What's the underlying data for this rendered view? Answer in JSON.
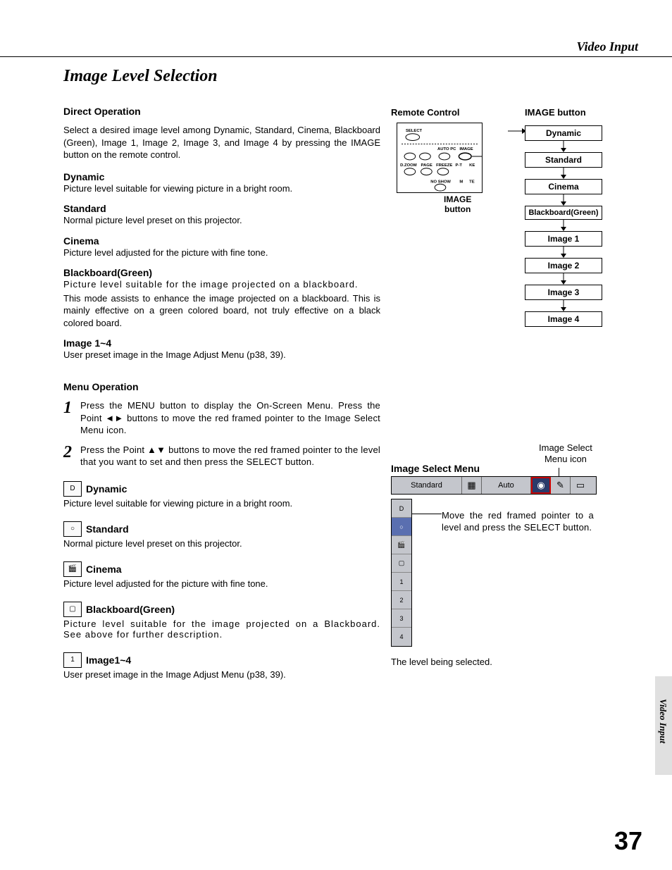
{
  "header": {
    "section": "Video Input"
  },
  "title": "Image Level Selection",
  "direct": {
    "heading": "Direct Operation",
    "intro": "Select a desired image level among Dynamic, Standard, Cinema, Blackboard (Green), Image 1, Image 2, Image 3, and Image 4 by pressing the IMAGE button on the remote control.",
    "defs": [
      {
        "t": "Dynamic",
        "b": "Picture level suitable for viewing picture in a bright room."
      },
      {
        "t": "Standard",
        "b": "Normal picture level preset on this projector."
      },
      {
        "t": "Cinema",
        "b": "Picture level adjusted for the picture with fine tone."
      },
      {
        "t": "Blackboard(Green)",
        "b": "Picture level suitable for the image projected on a blackboard.",
        "b2": "This mode assists to enhance the image projected on a blackboard.  This is mainly effective on a green colored board, not truly effective on a black colored board."
      },
      {
        "t": "Image 1~4",
        "b": "User preset image in the Image Adjust Menu (p38, 39)."
      }
    ]
  },
  "menu": {
    "heading": "Menu Operation",
    "steps": [
      "Press the MENU button to display the On-Screen Menu.  Press the Point ◄► buttons to move the red framed pointer to the Image Select Menu icon.",
      "Press the Point ▲▼ buttons to move the red framed pointer to the level that you want to set and then press the SELECT button."
    ],
    "items": [
      {
        "icon": "D",
        "name": "dynamic-icon",
        "t": "Dynamic",
        "b": "Picture level suitable for viewing picture in a bright room."
      },
      {
        "icon": "○",
        "name": "standard-icon",
        "t": "Standard",
        "b": "Normal picture level preset on this projector."
      },
      {
        "icon": "🎬",
        "name": "cinema-icon",
        "t": "Cinema",
        "b": "Picture level adjusted for the picture with fine tone."
      },
      {
        "icon": "▢",
        "name": "blackboard-icon",
        "t": "Blackboard(Green)",
        "b": "Picture level suitable for the image projected on a Blackboard.  See above for further description."
      },
      {
        "icon": "1",
        "name": "image14-icon",
        "t": "Image1~4",
        "b": "User preset image in the Image Adjust Menu (p38, 39)."
      }
    ]
  },
  "remote": {
    "title": "Remote Control",
    "image_button_title": "IMAGE button",
    "caption1": "IMAGE",
    "caption2": "button",
    "labels": {
      "select": "SELECT",
      "autopc": "AUTO PC",
      "image": "IMAGE",
      "dzoom": "D.ZOOM",
      "page": "PAGE",
      "freeze": "FREEZE",
      "pt": "P-T",
      "ke": "KE",
      "noshow": "NO SHOW",
      "m": "M",
      "te": "TE"
    }
  },
  "ladder": [
    "Dynamic",
    "Standard",
    "Cinema",
    "Blackboard(Green)",
    "Image 1",
    "Image 2",
    "Image 3",
    "Image 4"
  ],
  "ism": {
    "title": "Image Select Menu",
    "icon_label1": "Image Select",
    "icon_label2": "Menu icon",
    "topbar": {
      "current": "Standard",
      "mode": "Auto"
    },
    "rows": [
      "D",
      "○",
      "🎬",
      "▢",
      "1",
      "2",
      "3",
      "4"
    ],
    "pointer_text": "Move the red framed pointer to a level and press the SELECT button.",
    "selected_note": "The level being selected."
  },
  "side_tab": "Video Input",
  "page_number": "37"
}
